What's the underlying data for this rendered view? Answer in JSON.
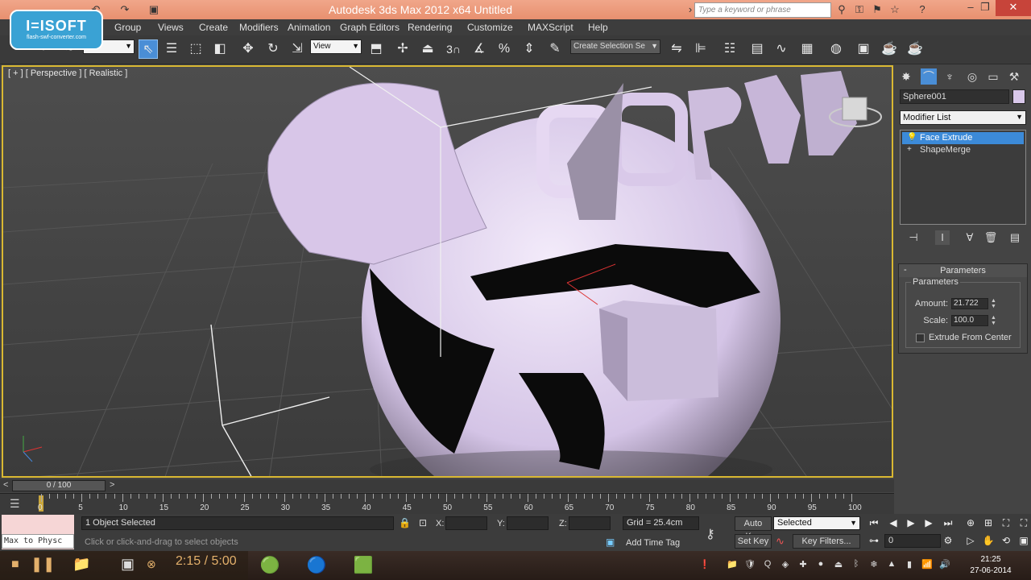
{
  "titlebar": {
    "title": "Autodesk 3ds Max  2012 x64      Untitled",
    "search_placeholder": "Type a keyword or phrase"
  },
  "logo": {
    "text": "I=ISOFT",
    "subtext": "flash-swf-converter.com"
  },
  "menu": [
    "Group",
    "Views",
    "Create",
    "Modifiers",
    "Animation",
    "Graph Editors",
    "Rendering",
    "Customize",
    "MAXScript",
    "Help"
  ],
  "toolbar": {
    "filter_dropdown": "",
    "refcoord_dropdown": "View",
    "selection_set": "Create Selection Se",
    "snap_label": "3"
  },
  "viewport": {
    "label": "[ + ] [ Perspective ] [ Realistic ]",
    "extruded_text": "COPYRI"
  },
  "command_panel": {
    "object_name": "Sphere001",
    "object_color": "#d9c8ea",
    "modifier_list": "Modifier List",
    "stack": [
      {
        "label": "Face Extrude",
        "selected": true
      },
      {
        "label": "ShapeMerge",
        "selected": false
      }
    ],
    "rollout_title": "Parameters",
    "group_title": "Parameters",
    "amount_label": "Amount:",
    "amount_value": "21.722",
    "scale_label": "Scale:",
    "scale_value": "100.0",
    "extrude_center_label": "Extrude From Center"
  },
  "timeline": {
    "slider_label": "0 / 100",
    "ticks": [
      "0",
      "5",
      "10",
      "15",
      "20",
      "25",
      "30",
      "35",
      "40",
      "45",
      "50",
      "55",
      "60",
      "65",
      "70",
      "75",
      "80",
      "85",
      "90",
      "95",
      "100"
    ]
  },
  "statusbar": {
    "maxscript_out": "Max to Physc",
    "selection_status": "1 Object Selected",
    "prompt": "Click or click-and-drag to select objects",
    "x_label": "X:",
    "y_label": "Y:",
    "z_label": "Z:",
    "grid": "Grid = 25.4cm",
    "add_time_tag": "Add Time Tag",
    "auto_key": "Auto Key",
    "set_key": "Set Key",
    "selected_dropdown": "Selected",
    "key_filters": "Key Filters...",
    "frame_value": "0"
  },
  "taskbar": {
    "player_time": "2:15 / 5:00",
    "clock_time": "21:25",
    "clock_date": "27-06-2014"
  }
}
